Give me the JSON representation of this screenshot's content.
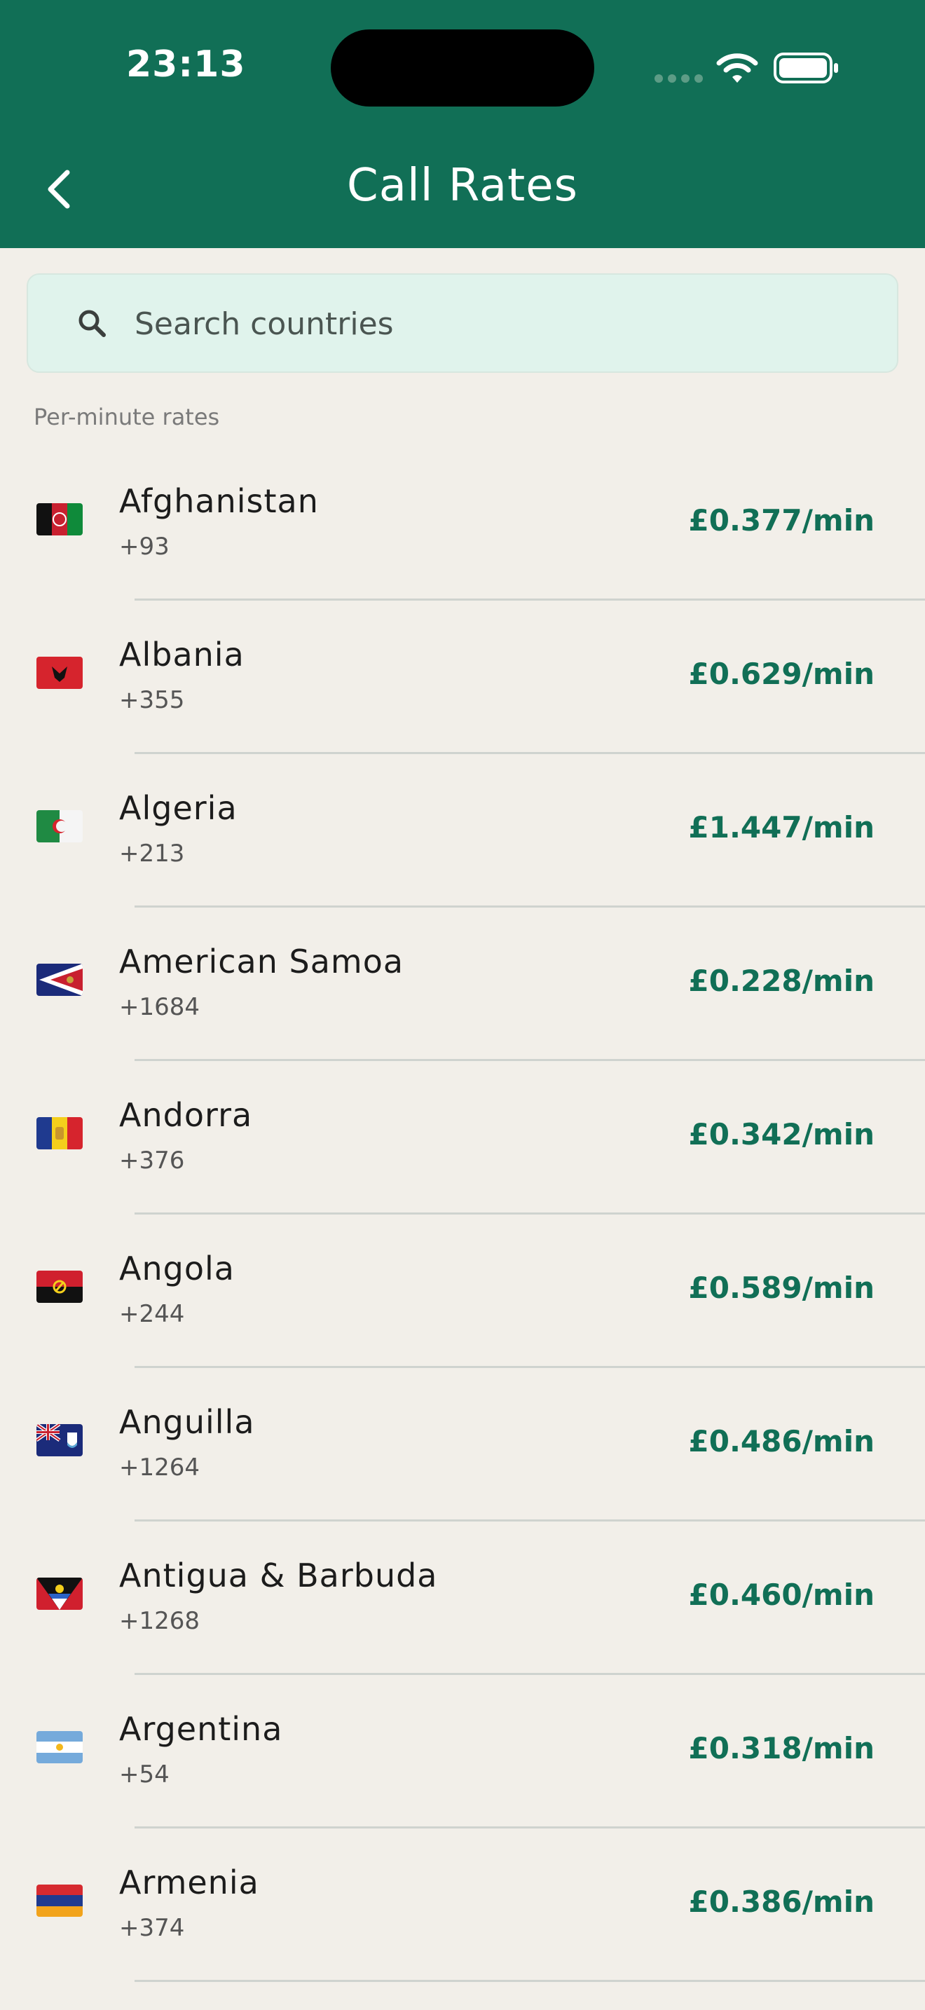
{
  "status_bar": {
    "time": "23:13"
  },
  "header": {
    "title": "Call Rates",
    "back_icon": "chevron-left-icon"
  },
  "search": {
    "placeholder": "Search countries",
    "value": "",
    "icon": "search-icon"
  },
  "section_label": "Per-minute rates",
  "colors": {
    "header": "#116f56",
    "accent": "#116f56",
    "background": "#f2efe9",
    "search_bg": "#e0f3ec"
  },
  "countries": [
    {
      "name": "Afghanistan",
      "dial": "+93",
      "rate": "£0.377/min",
      "flag": "afghanistan-flag-icon"
    },
    {
      "name": "Albania",
      "dial": "+355",
      "rate": "£0.629/min",
      "flag": "albania-flag-icon"
    },
    {
      "name": "Algeria",
      "dial": "+213",
      "rate": "£1.447/min",
      "flag": "algeria-flag-icon"
    },
    {
      "name": "American Samoa",
      "dial": "+1684",
      "rate": "£0.228/min",
      "flag": "american-samoa-flag-icon"
    },
    {
      "name": "Andorra",
      "dial": "+376",
      "rate": "£0.342/min",
      "flag": "andorra-flag-icon"
    },
    {
      "name": "Angola",
      "dial": "+244",
      "rate": "£0.589/min",
      "flag": "angola-flag-icon"
    },
    {
      "name": "Anguilla",
      "dial": "+1264",
      "rate": "£0.486/min",
      "flag": "anguilla-flag-icon"
    },
    {
      "name": "Antigua & Barbuda",
      "dial": "+1268",
      "rate": "£0.460/min",
      "flag": "antigua-barbuda-flag-icon"
    },
    {
      "name": "Argentina",
      "dial": "+54",
      "rate": "£0.318/min",
      "flag": "argentina-flag-icon"
    },
    {
      "name": "Armenia",
      "dial": "+374",
      "rate": "£0.386/min",
      "flag": "armenia-flag-icon"
    }
  ]
}
